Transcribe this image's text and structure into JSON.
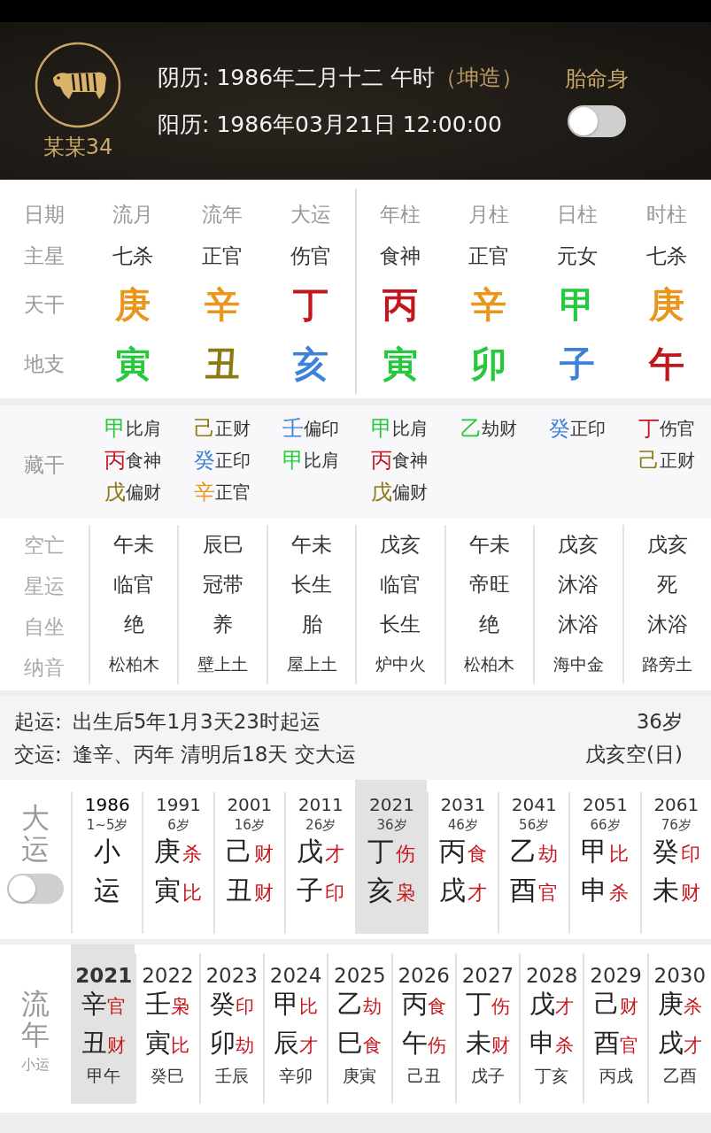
{
  "header": {
    "name": "某某34",
    "lunar_label": "阴历:",
    "lunar_value": "1986年二月十二 午时",
    "gender": "（坤造）",
    "solar_label": "阳历:",
    "solar_value": "1986年03月21日 12:00:00",
    "toggle": {
      "label": "胎命身",
      "on": false
    }
  },
  "pillars": {
    "row_labels": [
      "日期",
      "主星",
      "天干",
      "地支"
    ],
    "columns": [
      {
        "title": "流月",
        "star": "七杀",
        "stem": {
          "char": "庚",
          "color": "#e8961e"
        },
        "branch": {
          "char": "寅",
          "color": "#25c93c"
        }
      },
      {
        "title": "流年",
        "star": "正官",
        "stem": {
          "char": "辛",
          "color": "#e8961e"
        },
        "branch": {
          "char": "丑",
          "color": "#8b7a12"
        }
      },
      {
        "title": "大运",
        "star": "伤官",
        "stem": {
          "char": "丁",
          "color": "#c0161c"
        },
        "branch": {
          "char": "亥",
          "color": "#3b82d8"
        }
      },
      {
        "title": "年柱",
        "star": "食神",
        "stem": {
          "char": "丙",
          "color": "#c0161c"
        },
        "branch": {
          "char": "寅",
          "color": "#25c93c"
        }
      },
      {
        "title": "月柱",
        "star": "正官",
        "stem": {
          "char": "辛",
          "color": "#e8961e"
        },
        "branch": {
          "char": "卯",
          "color": "#25c93c"
        }
      },
      {
        "title": "日柱",
        "star": "元女",
        "stem": {
          "char": "甲",
          "color": "#25c93c"
        },
        "branch": {
          "char": "子",
          "color": "#3b82d8"
        }
      },
      {
        "title": "时柱",
        "star": "七杀",
        "stem": {
          "char": "庚",
          "color": "#e8961e"
        },
        "branch": {
          "char": "午",
          "color": "#c0161c"
        }
      }
    ]
  },
  "hidden_stems": {
    "label": "藏干",
    "columns": [
      [
        {
          "stem": "甲",
          "color": "#25c93c",
          "god": "比肩"
        },
        {
          "stem": "丙",
          "color": "#c0161c",
          "god": "食神"
        },
        {
          "stem": "戊",
          "color": "#8b7a12",
          "god": "偏财"
        }
      ],
      [
        {
          "stem": "己",
          "color": "#8b7a12",
          "god": "正财"
        },
        {
          "stem": "癸",
          "color": "#3b82d8",
          "god": "正印"
        },
        {
          "stem": "辛",
          "color": "#e8961e",
          "god": "正官"
        }
      ],
      [
        {
          "stem": "壬",
          "color": "#3b82d8",
          "god": "偏印"
        },
        {
          "stem": "甲",
          "color": "#25c93c",
          "god": "比肩"
        }
      ],
      [
        {
          "stem": "甲",
          "color": "#25c93c",
          "god": "比肩"
        },
        {
          "stem": "丙",
          "color": "#c0161c",
          "god": "食神"
        },
        {
          "stem": "戊",
          "color": "#8b7a12",
          "god": "偏财"
        }
      ],
      [
        {
          "stem": "乙",
          "color": "#25c93c",
          "god": "劫财"
        }
      ],
      [
        {
          "stem": "癸",
          "color": "#3b82d8",
          "god": "正印"
        }
      ],
      [
        {
          "stem": "丁",
          "color": "#c0161c",
          "god": "伤官"
        },
        {
          "stem": "己",
          "color": "#8b7a12",
          "god": "正财"
        }
      ]
    ]
  },
  "details": [
    {
      "label": "空亡",
      "kind": "normal",
      "values": [
        "午未",
        "辰巳",
        "午未",
        "戊亥",
        "午未",
        "戊亥",
        "戊亥"
      ]
    },
    {
      "label": "星运",
      "kind": "normal",
      "values": [
        "临官",
        "冠带",
        "长生",
        "临官",
        "帝旺",
        "沐浴",
        "死"
      ]
    },
    {
      "label": "自坐",
      "kind": "normal",
      "values": [
        "绝",
        "养",
        "胎",
        "长生",
        "绝",
        "沐浴",
        "沐浴"
      ]
    },
    {
      "label": "纳音",
      "kind": "small",
      "values": [
        "松柏木",
        "壁上土",
        "屋上土",
        "炉中火",
        "松柏木",
        "海中金",
        "路旁土"
      ]
    }
  ],
  "qiyun": [
    {
      "label": "起运:",
      "text": "出生后5年1月3天23时起运",
      "right": "36岁"
    },
    {
      "label": "交运:",
      "text": "逢辛、丙年 清明后18天 交大运",
      "right": "戊亥空(日)"
    }
  ],
  "dayun": {
    "label": "大运",
    "toggle": {
      "on": false
    },
    "items": [
      {
        "year": "1986",
        "age": "1~5岁",
        "stem": "小",
        "branch": "运",
        "selected": false
      },
      {
        "year": "1991",
        "age": "6岁",
        "stem": "庚",
        "stem_god": "杀",
        "branch": "寅",
        "branch_god": "比",
        "selected": false
      },
      {
        "year": "2001",
        "age": "16岁",
        "stem": "己",
        "stem_god": "财",
        "branch": "丑",
        "branch_god": "财",
        "selected": false
      },
      {
        "year": "2011",
        "age": "26岁",
        "stem": "戊",
        "stem_god": "才",
        "branch": "子",
        "branch_god": "印",
        "selected": false
      },
      {
        "year": "2021",
        "age": "36岁",
        "stem": "丁",
        "stem_god": "伤",
        "branch": "亥",
        "branch_god": "枭",
        "selected": true
      },
      {
        "year": "2031",
        "age": "46岁",
        "stem": "丙",
        "stem_god": "食",
        "branch": "戌",
        "branch_god": "才",
        "selected": false
      },
      {
        "year": "2041",
        "age": "56岁",
        "stem": "乙",
        "stem_god": "劫",
        "branch": "酉",
        "branch_god": "官",
        "selected": false
      },
      {
        "year": "2051",
        "age": "66岁",
        "stem": "甲",
        "stem_god": "比",
        "branch": "申",
        "branch_god": "杀",
        "selected": false
      },
      {
        "year": "2061",
        "age": "76岁",
        "stem": "癸",
        "stem_god": "印",
        "branch": "未",
        "branch_god": "财",
        "selected": false
      }
    ]
  },
  "liunian": {
    "label": "流年",
    "sublabel": "小运",
    "items": [
      {
        "year": "2021",
        "stem": "辛",
        "stem_god": "官",
        "branch": "丑",
        "branch_god": "财",
        "xiaoyun": "甲午",
        "selected": true
      },
      {
        "year": "2022",
        "stem": "壬",
        "stem_god": "枭",
        "branch": "寅",
        "branch_god": "比",
        "xiaoyun": "癸巳",
        "selected": false
      },
      {
        "year": "2023",
        "stem": "癸",
        "stem_god": "印",
        "branch": "卯",
        "branch_god": "劫",
        "xiaoyun": "壬辰",
        "selected": false
      },
      {
        "year": "2024",
        "stem": "甲",
        "stem_god": "比",
        "branch": "辰",
        "branch_god": "才",
        "xiaoyun": "辛卯",
        "selected": false
      },
      {
        "year": "2025",
        "stem": "乙",
        "stem_god": "劫",
        "branch": "巳",
        "branch_god": "食",
        "xiaoyun": "庚寅",
        "selected": false
      },
      {
        "year": "2026",
        "stem": "丙",
        "stem_god": "食",
        "branch": "午",
        "branch_god": "伤",
        "xiaoyun": "己丑",
        "selected": false
      },
      {
        "year": "2027",
        "stem": "丁",
        "stem_god": "伤",
        "branch": "未",
        "branch_god": "财",
        "xiaoyun": "戊子",
        "selected": false
      },
      {
        "year": "2028",
        "stem": "戊",
        "stem_god": "才",
        "branch": "申",
        "branch_god": "杀",
        "xiaoyun": "丁亥",
        "selected": false
      },
      {
        "year": "2029",
        "stem": "己",
        "stem_god": "财",
        "branch": "酉",
        "branch_god": "官",
        "xiaoyun": "丙戌",
        "selected": false
      },
      {
        "year": "2030",
        "stem": "庚",
        "stem_god": "杀",
        "branch": "戌",
        "branch_god": "才",
        "xiaoyun": "乙酉",
        "selected": false
      }
    ]
  }
}
